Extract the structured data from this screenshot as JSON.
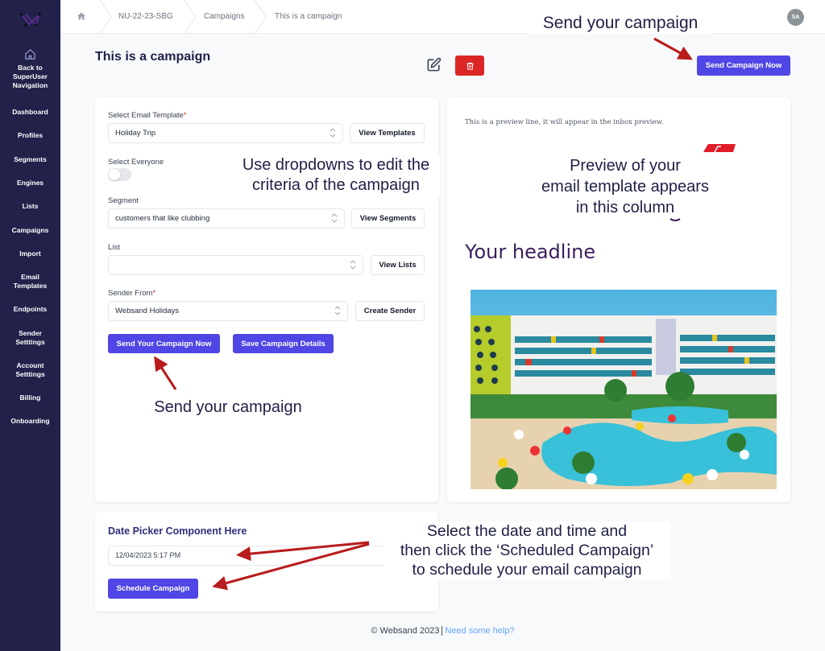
{
  "sidebar": {
    "home_label": "Back to SuperUser Navigation",
    "items": [
      {
        "label": "Dashboard"
      },
      {
        "label": "Profiles"
      },
      {
        "label": "Segments"
      },
      {
        "label": "Engines"
      },
      {
        "label": "Lists"
      },
      {
        "label": "Campaigns"
      },
      {
        "label": "Import"
      },
      {
        "label": "Email Templates"
      },
      {
        "label": "Endpoints"
      },
      {
        "label": "Sender Setttings"
      },
      {
        "label": "Account Setttings"
      },
      {
        "label": "Billing"
      },
      {
        "label": "Onboarding"
      }
    ]
  },
  "breadcrumb": [
    "NU-22-23-SBG",
    "Campaigns",
    "This is a campaign"
  ],
  "user": {
    "initials": "SA"
  },
  "page": {
    "title": "This is a campaign",
    "send_now_label": "Send Campaign Now"
  },
  "form": {
    "template_label": "Select Email Template",
    "template_value": "Holiday Trip",
    "view_templates": "View Templates",
    "everyone_label": "Select Everyone",
    "everyone_on": false,
    "segment_label": "Segment",
    "segment_value": "customers that like clubbing",
    "view_segments": "View Segments",
    "list_label": "List",
    "list_value": "",
    "view_lists": "View Lists",
    "sender_label": "Sender From",
    "sender_value": "Websand Holidays",
    "create_sender": "Create Sender",
    "send_now": "Send Your Campaign Now",
    "save_details": "Save Campaign Details",
    "required_mark": "*"
  },
  "preview": {
    "preview_line": "This is a preview line, it will appear in the inbox preview.",
    "headline": "Your headline",
    "image_alt": "hotel-pool-photo"
  },
  "schedule": {
    "title": "Date Picker Component Here",
    "date_value": "12/04/2023 5:17 PM",
    "button": "Schedule Campaign"
  },
  "annotations": {
    "send_top": "Send your campaign",
    "dropdowns": [
      "Use dropdowns to edit the",
      "criteria of the campaign"
    ],
    "preview": [
      "Preview of your",
      "email template appears",
      "in this column"
    ],
    "send_bottom": "Send your campaign",
    "schedule": [
      "Select the date and time and",
      "then click the ‘Scheduled Campaign’",
      "to schedule your email campaign"
    ]
  },
  "footer": {
    "copyright": "© Websand 2023",
    "help_link": "Need some help?"
  },
  "colors": {
    "sidebar": "#21214a",
    "primary": "#4f46e5",
    "danger": "#dc2626",
    "annotation_arrow": "#b91c1c",
    "link": "#60a5fa"
  }
}
